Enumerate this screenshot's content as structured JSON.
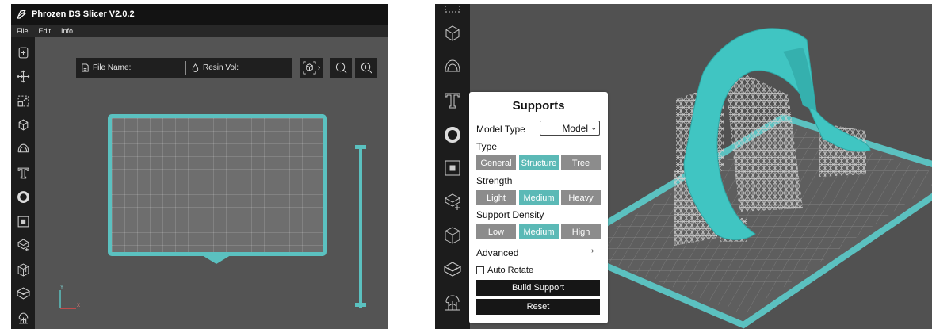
{
  "left_window": {
    "title": "Phrozen DS Slicer  V2.0.2",
    "menu": [
      "File",
      "Edit",
      "Info."
    ],
    "info_bar": {
      "file_name_label": "File Name:",
      "resin_vol_label": "Resin Vol:"
    },
    "view_cube_caret": "›",
    "axis_labels": {
      "y": "Y",
      "x": "X"
    }
  },
  "supports_panel": {
    "title": "Supports",
    "model_type_label": "Model Type",
    "model_type_value": "Model",
    "type_label": "Type",
    "type_options": [
      "General",
      "Structure",
      "Tree"
    ],
    "type_selected": "Structure",
    "strength_label": "Strength",
    "strength_options": [
      "Light",
      "Medium",
      "Heavy"
    ],
    "strength_selected": "Medium",
    "density_label": "Support Density",
    "density_options": [
      "Low",
      "Medium",
      "High"
    ],
    "density_selected": "Medium",
    "advanced_label": "Advanced",
    "advanced_chevron": "›",
    "auto_rotate_label": "Auto Rotate",
    "auto_rotate_checked": false,
    "build_support_label": "Build Support",
    "reset_label": "Reset"
  },
  "colors": {
    "accent_teal": "#5bc1c0",
    "toolbar_bg": "#1c1c1c",
    "viewport_bg": "#545454",
    "segment_off": "#8c8c8c",
    "segment_on": "#5bb9b6"
  },
  "icons": {
    "left_toolbar": [
      "add-file-icon",
      "move-icon",
      "scale-icon",
      "rotate-icon",
      "dental-arch-icon",
      "text-icon",
      "ring-icon",
      "square-icon",
      "auto-arrange-icon",
      "wireframe-cube-icon",
      "hollow-icon",
      "supports-icon"
    ],
    "right_toolbar": [
      "rotate-icon",
      "dental-arch-icon",
      "text-icon",
      "ring-icon",
      "square-icon",
      "auto-arrange-icon",
      "wireframe-cube-icon",
      "hollow-icon",
      "supports-icon"
    ]
  }
}
